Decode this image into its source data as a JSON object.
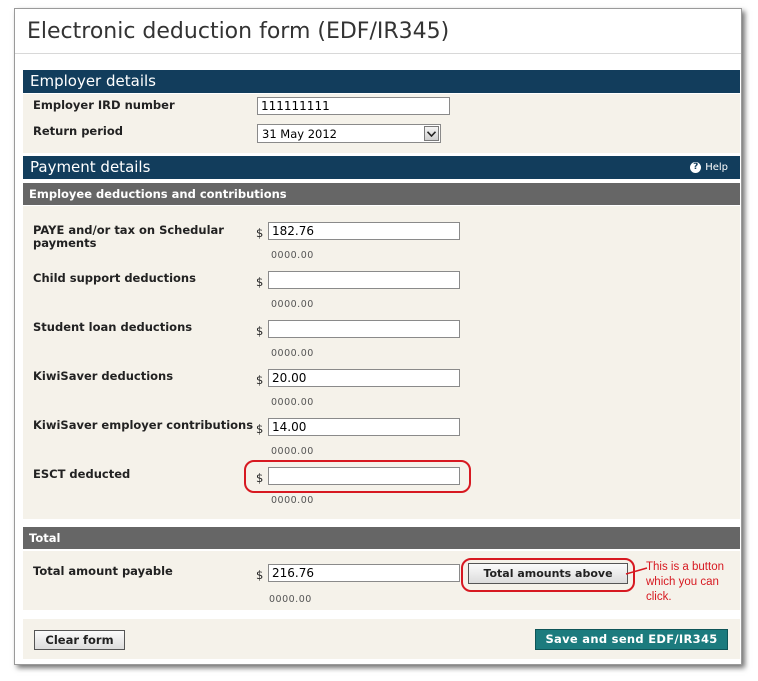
{
  "page": {
    "title": "Electronic deduction form (EDF/IR345)"
  },
  "employer": {
    "section_title": "Employer details",
    "ird_label": "Employer IRD number",
    "ird_value": "111111111",
    "period_label": "Return period",
    "period_value": "31 May 2012"
  },
  "payment": {
    "section_title": "Payment details",
    "help_label": "Help",
    "subsection_title": "Employee deductions and contributions",
    "currency_symbol": "$",
    "fields": [
      {
        "label": "PAYE and/or tax on Schedular payments",
        "value": "182.76",
        "hint": "0000.00"
      },
      {
        "label": "Child support deductions",
        "value": "",
        "hint": "0000.00"
      },
      {
        "label": "Student loan deductions",
        "value": "",
        "hint": "0000.00"
      },
      {
        "label": "KiwiSaver deductions",
        "value": "20.00",
        "hint": "0000.00"
      },
      {
        "label": "KiwiSaver employer contributions",
        "value": "14.00",
        "hint": "0000.00"
      },
      {
        "label": "ESCT deducted",
        "value": "",
        "hint": "0000.00"
      }
    ]
  },
  "total": {
    "section_title": "Total",
    "label": "Total amount payable",
    "value": "216.76",
    "hint": "0000.00",
    "button_label": "Total amounts above"
  },
  "annotation": {
    "text": "This is a button which you can click."
  },
  "actions": {
    "clear_label": "Clear form",
    "submit_label": "Save and send EDF/IR345"
  },
  "colors": {
    "section_bar": "#123d5c",
    "subsection_bar": "#666666",
    "panel_background": "#f5f2ea",
    "submit_button": "#1c7b7e",
    "annotation_red": "#d71921"
  }
}
